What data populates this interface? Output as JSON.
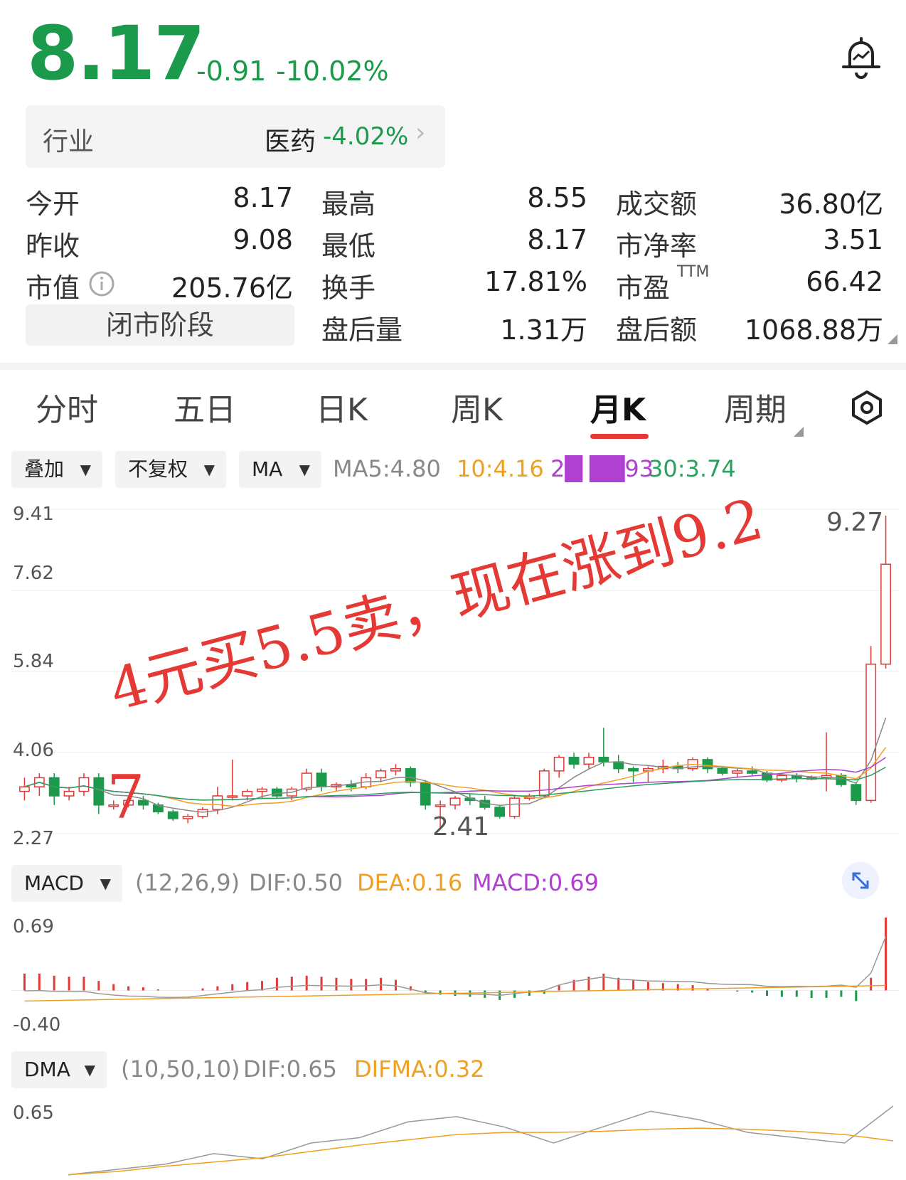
{
  "quote": {
    "price": "8.17",
    "change": "-0.91",
    "change_pct": "-10.02%"
  },
  "industry": {
    "label": "行业",
    "name": "医药",
    "change_pct": "-4.02%",
    "chevron": "›"
  },
  "stats": {
    "col1": [
      {
        "label": "今开",
        "value": "8.17",
        "color": "green"
      },
      {
        "label": "昨收",
        "value": "9.08",
        "color": "black"
      },
      {
        "label": "市值",
        "value": "205.76亿",
        "color": "black",
        "icon": "info-icon"
      }
    ],
    "col2": [
      {
        "label": "最高",
        "value": "8.55",
        "color": "green"
      },
      {
        "label": "最低",
        "value": "8.17",
        "color": "green"
      },
      {
        "label": "换手",
        "value": "17.81%",
        "color": "black"
      },
      {
        "label": "盘后量",
        "value": "1.31万",
        "color": "black"
      }
    ],
    "col3": [
      {
        "label": "成交额",
        "value": "36.80亿"
      },
      {
        "label": "市净率",
        "value": "3.51"
      },
      {
        "label": "市盈",
        "sup": "TTM",
        "value": "66.42"
      },
      {
        "label": "盘后额",
        "value": "1068.88万"
      }
    ],
    "market_status": "闭市阶段"
  },
  "tabs": [
    "分时",
    "五日",
    "日K",
    "周K",
    "月K",
    "周期"
  ],
  "active_tab": "月K",
  "controls": {
    "overlay": "叠加",
    "adjust": "不复权",
    "indicator": "MA",
    "settings_icon": "hexagon-gear-icon",
    "expand_icon": "expand-icon"
  },
  "ma_legend": {
    "ma5": "MA5:4.80",
    "ma10": "10:4.16",
    "ma20": "2█ ██93",
    "ma30": "30:3.74"
  },
  "kline_axis": [
    "9.41",
    "7.62",
    "5.84",
    "4.06",
    "2.27"
  ],
  "kline_labels": {
    "high": "9.27",
    "low": "2.41"
  },
  "annotation": {
    "line1": "4元买5.5卖，现在涨到9.2",
    "line2": "7"
  },
  "macd": {
    "name": "MACD",
    "params": "(12,26,9)",
    "dif": "DIF:0.50",
    "dea": "DEA:0.16",
    "macd": "MACD:0.69",
    "axis_top": "0.69",
    "axis_bottom": "-0.40"
  },
  "dma": {
    "name": "DMA",
    "params": "(10,50,10)",
    "dif": "DIF:0.65",
    "difma": "DIFMA:0.32",
    "axis_top": "0.65"
  },
  "colors": {
    "up": "#e53935",
    "down": "#1a9a4a",
    "ma5": "#888888",
    "ma10": "#f0a020",
    "ma20": "#b040d0",
    "ma30": "#2aa060"
  },
  "chart_data": [
    {
      "type": "candlestick",
      "title": "月K",
      "ylim": [
        2.27,
        9.41
      ],
      "candles": [
        [
          3.2,
          3.5,
          3.0,
          3.3
        ],
        [
          3.3,
          3.6,
          3.1,
          3.5
        ],
        [
          3.5,
          3.6,
          2.9,
          3.1
        ],
        [
          3.1,
          3.3,
          3.0,
          3.2
        ],
        [
          3.2,
          3.6,
          3.1,
          3.5
        ],
        [
          3.5,
          3.6,
          2.7,
          2.9
        ],
        [
          2.9,
          3.0,
          2.8,
          2.9
        ],
        [
          2.9,
          3.0,
          2.85,
          3.0
        ],
        [
          3.0,
          3.1,
          2.8,
          2.9
        ],
        [
          2.9,
          2.95,
          2.7,
          2.75
        ],
        [
          2.75,
          2.8,
          2.55,
          2.6
        ],
        [
          2.6,
          2.7,
          2.5,
          2.65
        ],
        [
          2.65,
          2.85,
          2.6,
          2.8
        ],
        [
          2.8,
          3.3,
          2.7,
          3.1
        ],
        [
          3.1,
          3.9,
          3.0,
          3.1
        ],
        [
          3.1,
          3.25,
          3.0,
          3.2
        ],
        [
          3.2,
          3.3,
          3.05,
          3.25
        ],
        [
          3.25,
          3.3,
          3.05,
          3.1
        ],
        [
          3.1,
          3.3,
          3.0,
          3.25
        ],
        [
          3.25,
          3.7,
          3.2,
          3.6
        ],
        [
          3.6,
          3.7,
          3.2,
          3.3
        ],
        [
          3.3,
          3.4,
          3.2,
          3.35
        ],
        [
          3.35,
          3.45,
          3.2,
          3.3
        ],
        [
          3.3,
          3.6,
          3.25,
          3.5
        ],
        [
          3.5,
          3.7,
          3.4,
          3.65
        ],
        [
          3.65,
          3.8,
          3.55,
          3.7
        ],
        [
          3.7,
          3.75,
          3.3,
          3.4
        ],
        [
          3.4,
          3.45,
          2.8,
          2.9
        ],
        [
          2.9,
          3.0,
          2.41,
          2.9
        ],
        [
          2.9,
          3.1,
          2.8,
          3.05
        ],
        [
          3.05,
          3.15,
          2.9,
          3.0
        ],
        [
          3.0,
          3.1,
          2.8,
          2.85
        ],
        [
          2.85,
          2.9,
          2.6,
          2.65
        ],
        [
          2.65,
          3.1,
          2.6,
          3.05
        ],
        [
          3.05,
          3.15,
          3.0,
          3.1
        ],
        [
          3.1,
          3.7,
          3.05,
          3.65
        ],
        [
          3.65,
          4.0,
          3.5,
          3.95
        ],
        [
          3.95,
          4.05,
          3.7,
          3.8
        ],
        [
          3.8,
          4.05,
          3.7,
          3.95
        ],
        [
          3.95,
          4.6,
          3.75,
          3.85
        ],
        [
          3.85,
          4.0,
          3.6,
          3.7
        ],
        [
          3.7,
          3.75,
          3.4,
          3.65
        ],
        [
          3.65,
          3.75,
          3.4,
          3.7
        ],
        [
          3.7,
          3.9,
          3.6,
          3.75
        ],
        [
          3.75,
          3.85,
          3.6,
          3.7
        ],
        [
          3.7,
          3.95,
          3.65,
          3.9
        ],
        [
          3.9,
          3.95,
          3.6,
          3.7
        ],
        [
          3.7,
          3.75,
          3.55,
          3.6
        ],
        [
          3.6,
          3.7,
          3.5,
          3.65
        ],
        [
          3.65,
          3.75,
          3.55,
          3.6
        ],
        [
          3.6,
          3.65,
          3.4,
          3.45
        ],
        [
          3.45,
          3.6,
          3.4,
          3.55
        ],
        [
          3.55,
          3.6,
          3.4,
          3.5
        ],
        [
          3.5,
          3.55,
          3.45,
          3.5
        ],
        [
          3.5,
          4.5,
          3.2,
          3.55
        ],
        [
          3.55,
          3.6,
          3.3,
          3.35
        ],
        [
          3.35,
          3.4,
          2.9,
          3.0
        ],
        [
          3.0,
          6.4,
          2.95,
          6.0
        ],
        [
          6.0,
          9.27,
          5.9,
          8.2
        ]
      ]
    },
    {
      "type": "bar",
      "title": "MACD",
      "ylim": [
        -0.4,
        0.69
      ],
      "values": [
        0.16,
        0.16,
        0.14,
        0.13,
        0.13,
        0.09,
        0.06,
        0.04,
        0.03,
        0.01,
        0.0,
        0.0,
        0.02,
        0.04,
        0.06,
        0.08,
        0.09,
        0.12,
        0.13,
        0.14,
        0.13,
        0.12,
        0.11,
        0.11,
        0.12,
        0.1,
        0.04,
        -0.02,
        -0.04,
        -0.05,
        -0.06,
        -0.07,
        -0.09,
        -0.07,
        -0.05,
        -0.03,
        0.05,
        0.1,
        0.13,
        0.16,
        0.12,
        0.1,
        0.08,
        0.07,
        0.06,
        0.05,
        0.02,
        0.0,
        -0.01,
        -0.02,
        -0.05,
        -0.06,
        -0.06,
        -0.07,
        -0.07,
        -0.06,
        -0.1,
        0.12,
        0.69
      ]
    },
    {
      "type": "line",
      "title": "DMA",
      "series": [
        {
          "name": "DIF",
          "values": [
            0.0,
            0.05,
            0.1,
            0.2,
            0.15,
            0.3,
            0.35,
            0.5,
            0.55,
            0.45,
            0.3,
            0.45,
            0.6,
            0.52,
            0.4,
            0.35,
            0.3,
            0.65
          ]
        },
        {
          "name": "DIFMA",
          "values": [
            0.0,
            0.03,
            0.08,
            0.12,
            0.16,
            0.22,
            0.28,
            0.33,
            0.38,
            0.4,
            0.4,
            0.41,
            0.43,
            0.44,
            0.43,
            0.41,
            0.38,
            0.32
          ]
        }
      ]
    }
  ]
}
